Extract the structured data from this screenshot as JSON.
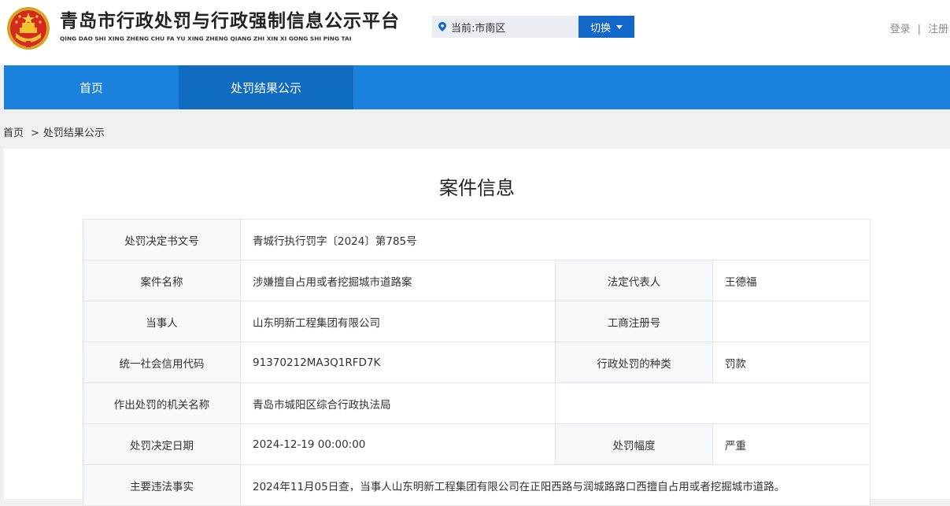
{
  "header": {
    "title_cn": "青岛市行政处罚与行政强制信息公示平台",
    "title_pinyin": "QING DAO SHI XING ZHENG CHU FA YU XING ZHENG QIANG ZHI XIN XI GONG SHI PING TAI",
    "location_text": "当前:市南区",
    "switch_label": "切换",
    "login": "登录",
    "separator": "|",
    "register": "注册",
    "emblem_icon": "national-emblem-icon",
    "location_icon": "location-pin-icon"
  },
  "nav": {
    "items": [
      {
        "label": "首页"
      },
      {
        "label": "处罚结果公示"
      }
    ]
  },
  "breadcrumb": {
    "home": "首页",
    "separator": ">",
    "current": "处罚结果公示"
  },
  "panel": {
    "title": "案件信息"
  },
  "case": {
    "decision_no_label": "处罚决定书文号",
    "decision_no": "青城行执行罚字〔2024〕第785号",
    "case_name_label": "案件名称",
    "case_name": "涉嫌擅自占用或者挖掘城市道路案",
    "legal_rep_label": "法定代表人",
    "legal_rep": "王德福",
    "party_label": "当事人",
    "party": "山东明新工程集团有限公司",
    "reg_no_label": "工商注册号",
    "reg_no": "",
    "credit_code_label": "统一社会信用代码",
    "credit_code": "91370212MA3Q1RFD7K",
    "penalty_type_label": "行政处罚的种类",
    "penalty_type": "罚款",
    "authority_label": "作出处罚的机关名称",
    "authority": "青岛市城阳区综合行政执法局",
    "decision_date_label": "处罚决定日期",
    "decision_date": "2024-12-19 00:00:00",
    "severity_label": "处罚幅度",
    "severity": "严重",
    "facts_label": "主要违法事实",
    "facts": "2024年11月05日查，当事人山东明新工程集团有限公司在正阳西路与润城路路口西擅自占用或者挖掘城市道路。"
  },
  "colors": {
    "nav_bg": "#1a81dc",
    "nav_active": "#0f6cc1",
    "switch_bg": "#1168c8"
  }
}
